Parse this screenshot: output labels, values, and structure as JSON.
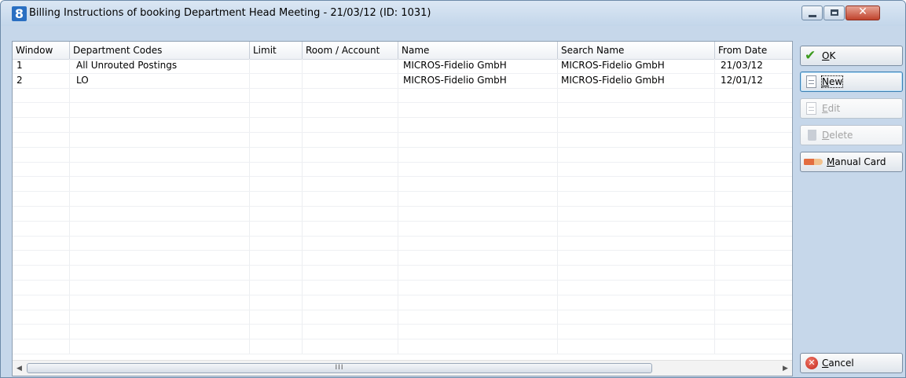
{
  "window": {
    "title": "Billing Instructions of booking Department Head Meeting - 21/03/12 (ID: 1031)",
    "app_icon_glyph": "8",
    "controls": {
      "minimize_icon": "minimize-icon",
      "maximize_icon": "maximize-icon",
      "close_icon": "close-icon",
      "close_glyph": "✕"
    }
  },
  "table": {
    "columns": [
      "Window",
      "Department Codes",
      "Limit",
      "Room / Account",
      "Name",
      "Search Name",
      "From Date"
    ],
    "rows": [
      {
        "window": "1",
        "department_codes": "All Unrouted Postings",
        "limit": "",
        "room_account": "",
        "name": "MICROS-Fidelio GmbH",
        "search_name": "MICROS-Fidelio GmbH",
        "from_date": "21/03/12"
      },
      {
        "window": "2",
        "department_codes": "LO",
        "limit": "",
        "room_account": "",
        "name": "MICROS-Fidelio GmbH",
        "search_name": "MICROS-Fidelio GmbH",
        "from_date": "12/01/12"
      }
    ],
    "empty_rows": 18,
    "hscroll": {
      "left_arrow": "◀",
      "right_arrow": "▶",
      "thumb_grip": "III"
    }
  },
  "buttons": {
    "ok": {
      "mnemonic": "O",
      "rest": "K",
      "icon": "check-icon",
      "glyph": "✔"
    },
    "new": {
      "mnemonic": "N",
      "rest": "ew",
      "icon": "document-icon"
    },
    "edit": {
      "mnemonic": "E",
      "rest": "dit",
      "icon": "edit-document-icon"
    },
    "delete": {
      "mnemonic": "D",
      "rest": "elete",
      "icon": "trash-icon"
    },
    "manual_card": {
      "mnemonic": "M",
      "rest": "anual Card",
      "icon": "card-swipe-icon"
    },
    "cancel": {
      "mnemonic": "C",
      "rest": "ancel",
      "icon": "cancel-icon",
      "glyph": "✕"
    }
  },
  "colors": {
    "titlebar": "#c3d6ea",
    "close_button": "#c0432d",
    "ok_check": "#3c9a1e",
    "cancel_icon": "#c3261a"
  }
}
